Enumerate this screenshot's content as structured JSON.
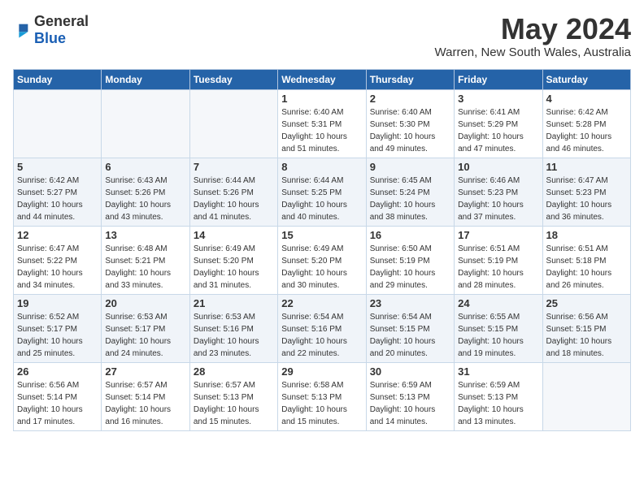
{
  "logo": {
    "general": "General",
    "blue": "Blue"
  },
  "title": {
    "month_year": "May 2024",
    "location": "Warren, New South Wales, Australia"
  },
  "headers": [
    "Sunday",
    "Monday",
    "Tuesday",
    "Wednesday",
    "Thursday",
    "Friday",
    "Saturday"
  ],
  "weeks": [
    {
      "alt": false,
      "days": [
        {
          "num": "",
          "info": ""
        },
        {
          "num": "",
          "info": ""
        },
        {
          "num": "",
          "info": ""
        },
        {
          "num": "1",
          "info": "Sunrise: 6:40 AM\nSunset: 5:31 PM\nDaylight: 10 hours\nand 51 minutes."
        },
        {
          "num": "2",
          "info": "Sunrise: 6:40 AM\nSunset: 5:30 PM\nDaylight: 10 hours\nand 49 minutes."
        },
        {
          "num": "3",
          "info": "Sunrise: 6:41 AM\nSunset: 5:29 PM\nDaylight: 10 hours\nand 47 minutes."
        },
        {
          "num": "4",
          "info": "Sunrise: 6:42 AM\nSunset: 5:28 PM\nDaylight: 10 hours\nand 46 minutes."
        }
      ]
    },
    {
      "alt": true,
      "days": [
        {
          "num": "5",
          "info": "Sunrise: 6:42 AM\nSunset: 5:27 PM\nDaylight: 10 hours\nand 44 minutes."
        },
        {
          "num": "6",
          "info": "Sunrise: 6:43 AM\nSunset: 5:26 PM\nDaylight: 10 hours\nand 43 minutes."
        },
        {
          "num": "7",
          "info": "Sunrise: 6:44 AM\nSunset: 5:26 PM\nDaylight: 10 hours\nand 41 minutes."
        },
        {
          "num": "8",
          "info": "Sunrise: 6:44 AM\nSunset: 5:25 PM\nDaylight: 10 hours\nand 40 minutes."
        },
        {
          "num": "9",
          "info": "Sunrise: 6:45 AM\nSunset: 5:24 PM\nDaylight: 10 hours\nand 38 minutes."
        },
        {
          "num": "10",
          "info": "Sunrise: 6:46 AM\nSunset: 5:23 PM\nDaylight: 10 hours\nand 37 minutes."
        },
        {
          "num": "11",
          "info": "Sunrise: 6:47 AM\nSunset: 5:23 PM\nDaylight: 10 hours\nand 36 minutes."
        }
      ]
    },
    {
      "alt": false,
      "days": [
        {
          "num": "12",
          "info": "Sunrise: 6:47 AM\nSunset: 5:22 PM\nDaylight: 10 hours\nand 34 minutes."
        },
        {
          "num": "13",
          "info": "Sunrise: 6:48 AM\nSunset: 5:21 PM\nDaylight: 10 hours\nand 33 minutes."
        },
        {
          "num": "14",
          "info": "Sunrise: 6:49 AM\nSunset: 5:20 PM\nDaylight: 10 hours\nand 31 minutes."
        },
        {
          "num": "15",
          "info": "Sunrise: 6:49 AM\nSunset: 5:20 PM\nDaylight: 10 hours\nand 30 minutes."
        },
        {
          "num": "16",
          "info": "Sunrise: 6:50 AM\nSunset: 5:19 PM\nDaylight: 10 hours\nand 29 minutes."
        },
        {
          "num": "17",
          "info": "Sunrise: 6:51 AM\nSunset: 5:19 PM\nDaylight: 10 hours\nand 28 minutes."
        },
        {
          "num": "18",
          "info": "Sunrise: 6:51 AM\nSunset: 5:18 PM\nDaylight: 10 hours\nand 26 minutes."
        }
      ]
    },
    {
      "alt": true,
      "days": [
        {
          "num": "19",
          "info": "Sunrise: 6:52 AM\nSunset: 5:17 PM\nDaylight: 10 hours\nand 25 minutes."
        },
        {
          "num": "20",
          "info": "Sunrise: 6:53 AM\nSunset: 5:17 PM\nDaylight: 10 hours\nand 24 minutes."
        },
        {
          "num": "21",
          "info": "Sunrise: 6:53 AM\nSunset: 5:16 PM\nDaylight: 10 hours\nand 23 minutes."
        },
        {
          "num": "22",
          "info": "Sunrise: 6:54 AM\nSunset: 5:16 PM\nDaylight: 10 hours\nand 22 minutes."
        },
        {
          "num": "23",
          "info": "Sunrise: 6:54 AM\nSunset: 5:15 PM\nDaylight: 10 hours\nand 20 minutes."
        },
        {
          "num": "24",
          "info": "Sunrise: 6:55 AM\nSunset: 5:15 PM\nDaylight: 10 hours\nand 19 minutes."
        },
        {
          "num": "25",
          "info": "Sunrise: 6:56 AM\nSunset: 5:15 PM\nDaylight: 10 hours\nand 18 minutes."
        }
      ]
    },
    {
      "alt": false,
      "days": [
        {
          "num": "26",
          "info": "Sunrise: 6:56 AM\nSunset: 5:14 PM\nDaylight: 10 hours\nand 17 minutes."
        },
        {
          "num": "27",
          "info": "Sunrise: 6:57 AM\nSunset: 5:14 PM\nDaylight: 10 hours\nand 16 minutes."
        },
        {
          "num": "28",
          "info": "Sunrise: 6:57 AM\nSunset: 5:13 PM\nDaylight: 10 hours\nand 15 minutes."
        },
        {
          "num": "29",
          "info": "Sunrise: 6:58 AM\nSunset: 5:13 PM\nDaylight: 10 hours\nand 15 minutes."
        },
        {
          "num": "30",
          "info": "Sunrise: 6:59 AM\nSunset: 5:13 PM\nDaylight: 10 hours\nand 14 minutes."
        },
        {
          "num": "31",
          "info": "Sunrise: 6:59 AM\nSunset: 5:13 PM\nDaylight: 10 hours\nand 13 minutes."
        },
        {
          "num": "",
          "info": ""
        }
      ]
    }
  ]
}
